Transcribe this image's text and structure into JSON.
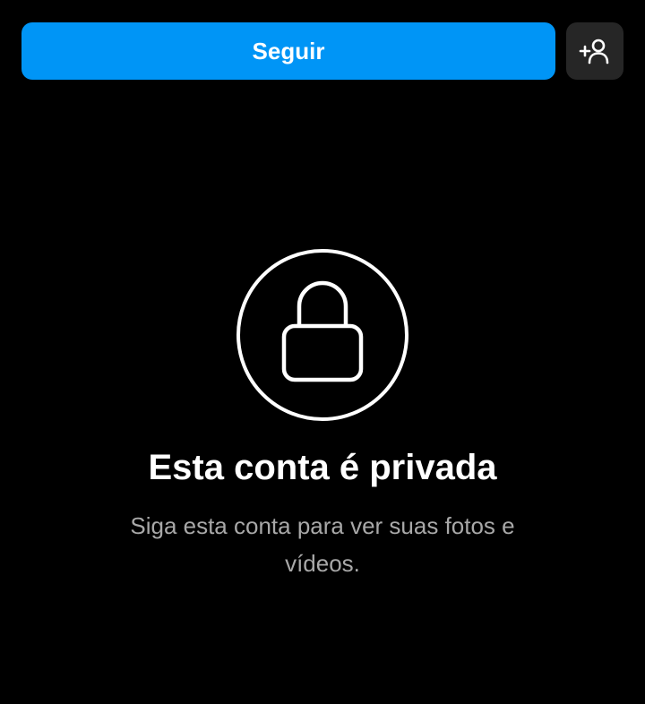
{
  "actions": {
    "follow_label": "Seguir",
    "suggest_icon": "person-add-icon"
  },
  "private_notice": {
    "icon": "lock-icon",
    "title": "Esta conta é privada",
    "subtitle": "Siga esta conta para ver suas fotos e vídeos."
  },
  "colors": {
    "background": "#000000",
    "accent": "#0095f6",
    "secondary_button": "#262626",
    "muted_text": "#a8a8a8"
  }
}
